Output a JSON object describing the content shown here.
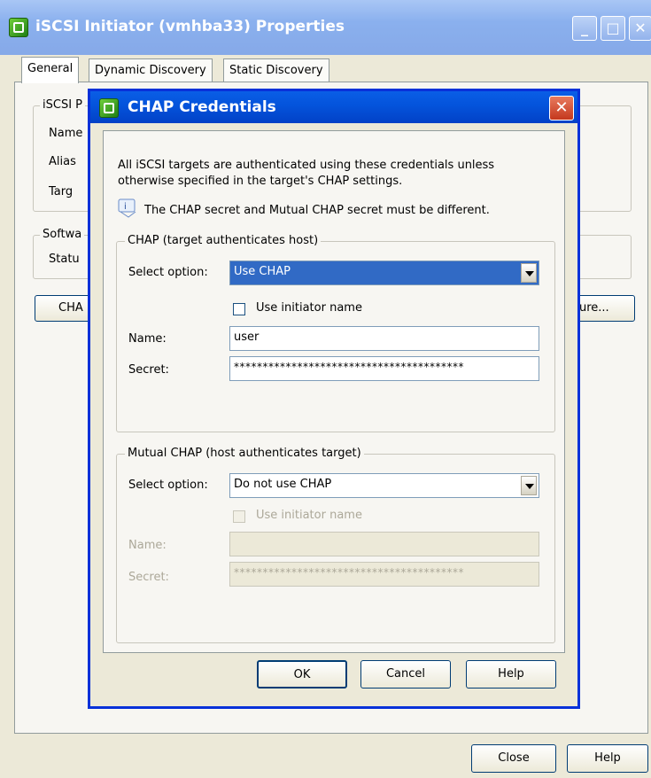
{
  "outer": {
    "title": "iSCSI Initiator (vmhba33) Properties",
    "tabs": [
      "General",
      "Dynamic Discovery",
      "Static Discovery"
    ],
    "group1_legend": "iSCSI P",
    "group1_labels": [
      "Name",
      "Alias",
      "Targ"
    ],
    "group2_legend": "Softwa",
    "group2_label": "Statu",
    "chap_button_partial": "CHA",
    "configure_button_partial": "ure...",
    "close_label": "Close",
    "help_label": "Help"
  },
  "dialog": {
    "title": "CHAP Credentials",
    "intro": "All iSCSI targets are authenticated using these credentials unless otherwise specified in the target's CHAP settings.",
    "info_note": "The CHAP secret and Mutual CHAP secret must be different.",
    "chap_group": {
      "legend": "CHAP (target authenticates host)",
      "select_label": "Select option:",
      "select_value": "Use CHAP",
      "use_initiator_label": "Use initiator name",
      "use_initiator_checked": false,
      "name_label": "Name:",
      "name_value": "user",
      "secret_label": "Secret:",
      "secret_value": "****************************************"
    },
    "mutual_group": {
      "legend": "Mutual CHAP (host authenticates target)",
      "select_label": "Select option:",
      "select_value": "Do not use CHAP",
      "use_initiator_label": "Use initiator name",
      "use_initiator_checked": false,
      "name_label": "Name:",
      "name_value": "",
      "secret_label": "Secret:",
      "secret_value": "****************************************"
    },
    "buttons": {
      "ok": "OK",
      "cancel": "Cancel",
      "help": "Help"
    }
  }
}
